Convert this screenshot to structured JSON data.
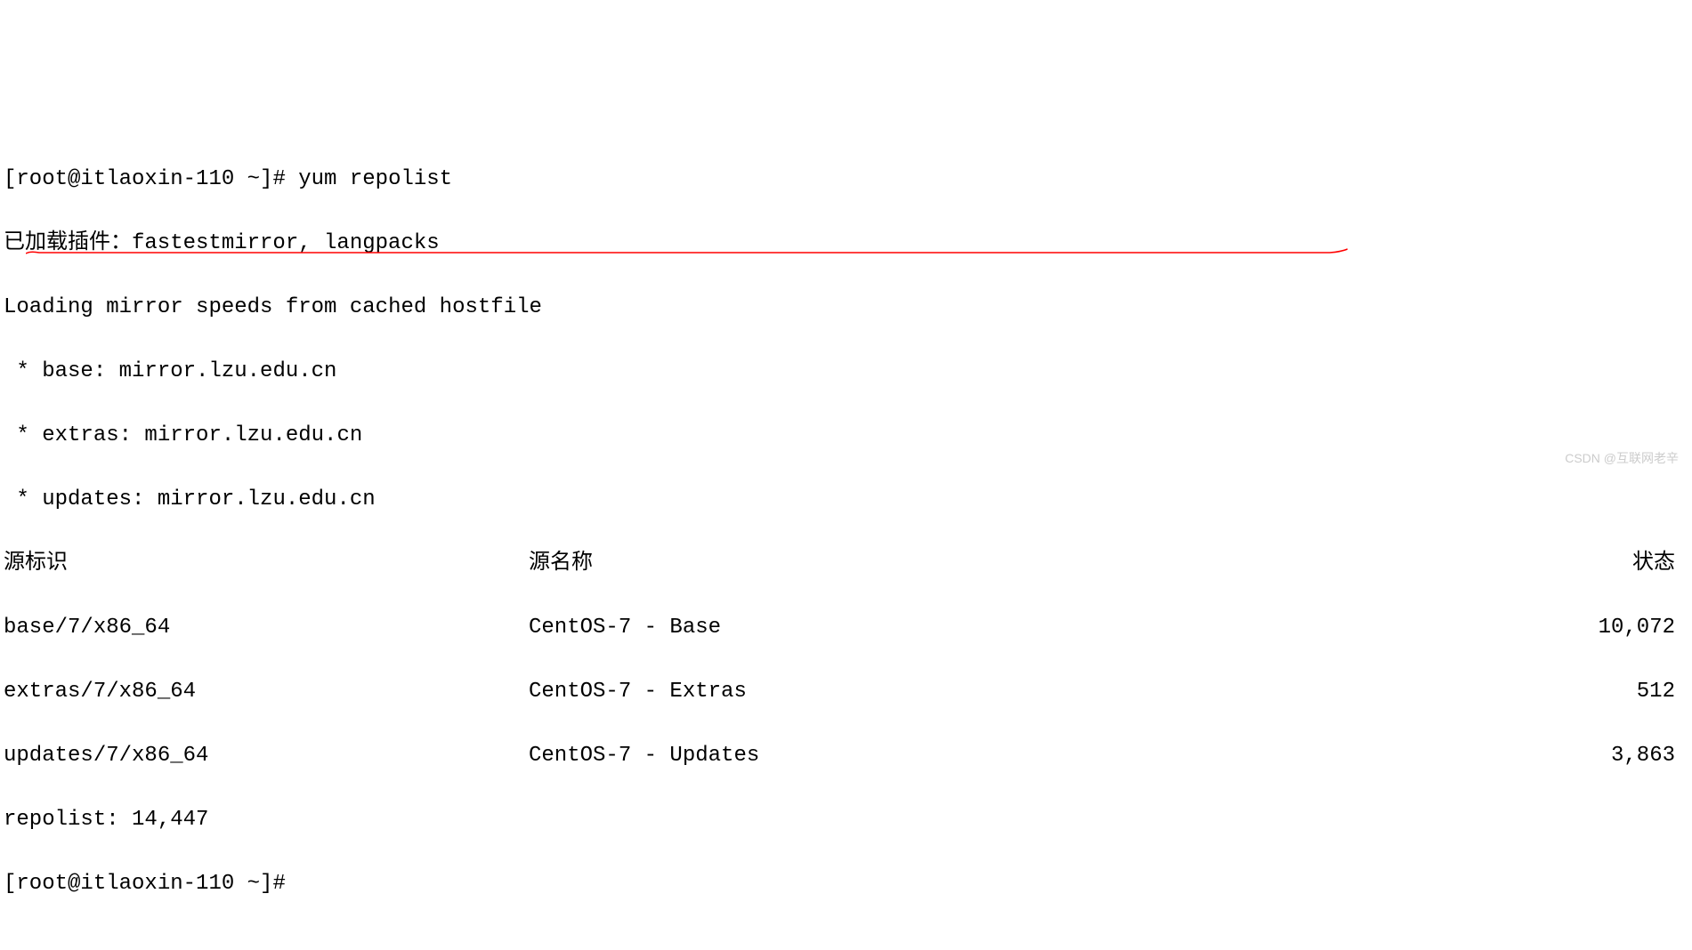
{
  "prompt1": "[root@itlaoxin-110 ~]# yum repolist",
  "plugins_line": "已加载插件：fastestmirror, langpacks",
  "loading_line": "Loading mirror speeds from cached hostfile",
  "mirrors": {
    "base": " * base: mirror.lzu.edu.cn",
    "extras": " * extras: mirror.lzu.edu.cn",
    "updates": " * updates: mirror.lzu.edu.cn"
  },
  "headers": {
    "id": "源标识",
    "name": "源名称",
    "status": "状态"
  },
  "repos": [
    {
      "id": "base/7/x86_64",
      "name": "CentOS-7 - Base",
      "status": "10,072"
    },
    {
      "id": "extras/7/x86_64",
      "name": "CentOS-7 - Extras",
      "status": "512"
    },
    {
      "id": "updates/7/x86_64",
      "name": "CentOS-7 - Updates",
      "status": "3,863"
    }
  ],
  "repolist_total": "repolist: 14,447",
  "prompt2": "[root@itlaoxin-110 ~]# ",
  "watermark": "CSDN @互联网老辛"
}
